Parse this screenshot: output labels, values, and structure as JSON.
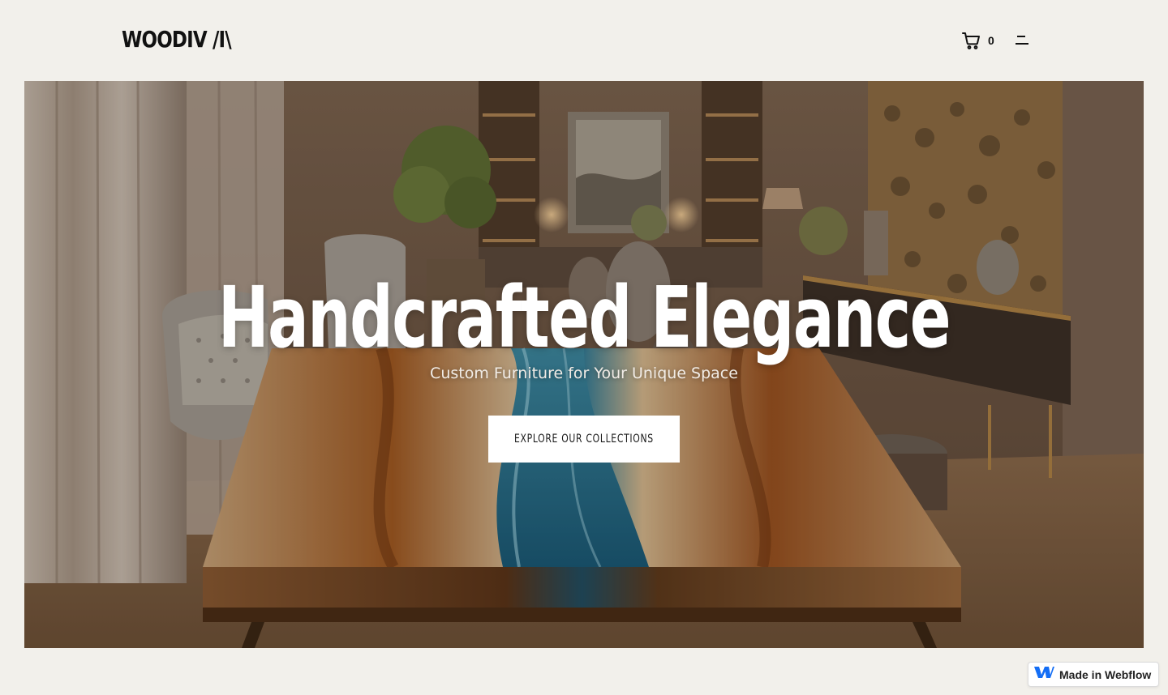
{
  "header": {
    "logo": "WOODIV /I\\",
    "cart_icon": "cart-icon",
    "cart_count": "0",
    "menu_icon": "menu-icon"
  },
  "hero": {
    "title": "Handcrafted Elegance",
    "subtitle": "Custom Furniture for Your Unique Space",
    "cta_label": "EXPLORE OUR COLLECTIONS",
    "image": "dining-room-river-table-photo"
  },
  "badge": {
    "label": "Made in Webflow",
    "icon": "webflow-logo-icon"
  },
  "colors": {
    "page_bg": "#f2f0eb",
    "text_dark": "#111111",
    "cta_bg": "#ffffff",
    "webflow_blue": "#146ef5"
  }
}
